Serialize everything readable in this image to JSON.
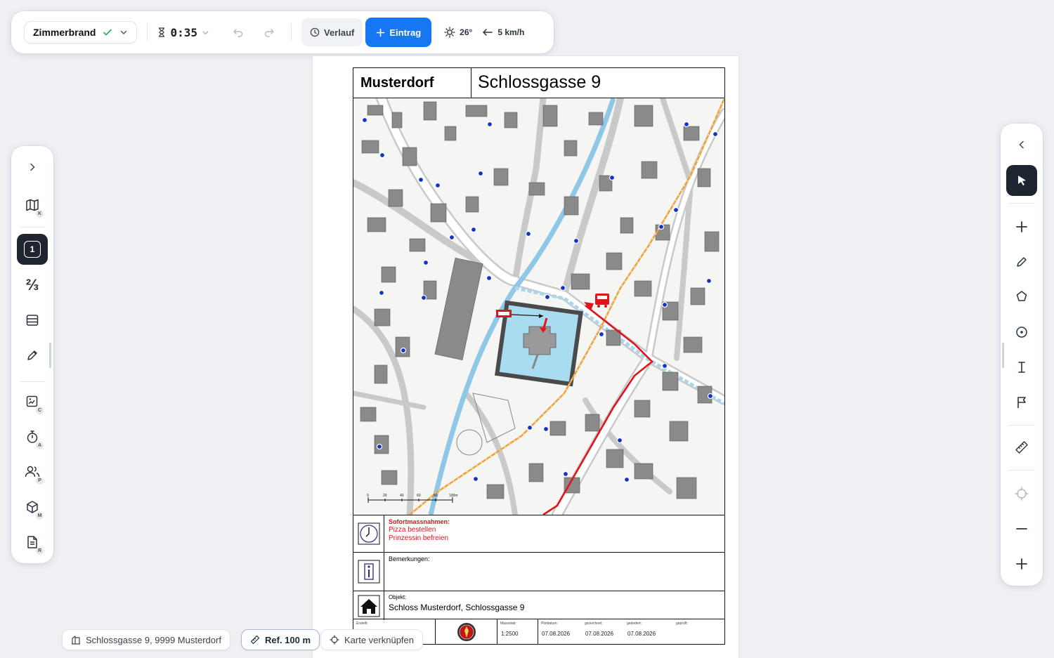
{
  "toolbar": {
    "incident_name": "Zimmerbrand",
    "timer": "0:35",
    "history_label": "Verlauf",
    "entry_label": "Eintrag",
    "temperature": "26°",
    "wind": "5 km/h"
  },
  "sidebar": {
    "items": [
      {
        "name": "map",
        "badge": "K"
      },
      {
        "name": "page-1",
        "label": "1"
      },
      {
        "name": "fraction",
        "label": "⅔"
      },
      {
        "name": "layers"
      },
      {
        "name": "pen"
      },
      {
        "name": "image",
        "badge": "C"
      },
      {
        "name": "timer",
        "badge": "A"
      },
      {
        "name": "people",
        "badge": "P"
      },
      {
        "name": "box",
        "badge": "M"
      },
      {
        "name": "document",
        "badge": "R"
      }
    ]
  },
  "document": {
    "municipality": "Musterdorf",
    "address": "Schlossgasse 9",
    "immediate_title": "Sofortmassnahmen:",
    "immediate_items": [
      "Pizza bestellen",
      "Prinzessin befreien"
    ],
    "remarks_label": "Bemerkungen:",
    "object_label": "Objekt:",
    "object_value": "Schloss Musterdorf,  Schlossgasse 9",
    "footer": {
      "created_label": "Erstellt:",
      "scale_label": "Massstab:",
      "scale_value": "1:2500",
      "photo_label": "Plotdatum:",
      "photo_value": "07.08.2026",
      "drawn_label": "gezeichnet:",
      "drawn_value": "07.08.2026",
      "changed_label": "geändert:",
      "changed_value": "07.08.2026",
      "checked_label": "geprüft:"
    },
    "scalebar": [
      "0",
      "20",
      "40",
      "60",
      "80",
      "100m"
    ]
  },
  "bottom": {
    "address_chip": "Schlossgasse 9, 9999 Musterdorf",
    "ref_chip": "Ref. 100 m",
    "link_chip": "Karte verknüpfen"
  },
  "colors": {
    "accent": "#1677f2",
    "route": "#e0141b",
    "water": "#9fd3ea",
    "hydrant": "#1133cc"
  }
}
